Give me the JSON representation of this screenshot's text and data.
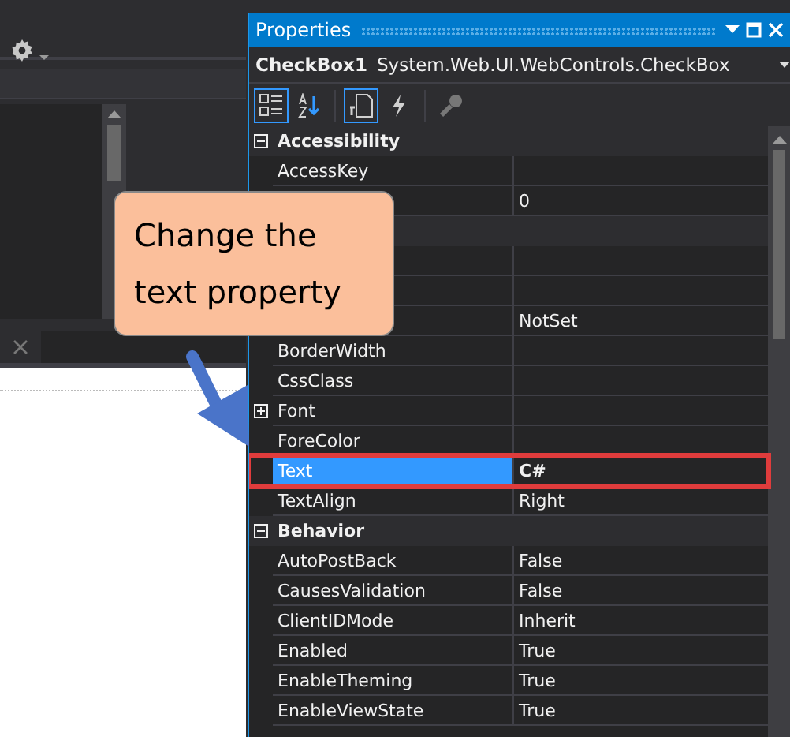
{
  "properties": {
    "title": "Properties",
    "object_name": "CheckBox1",
    "object_type": "System.Web.UI.WebControls.CheckBox",
    "toolbar": [
      {
        "kind": "categorized",
        "selected": true,
        "disabled": false
      },
      {
        "kind": "alphabetical",
        "selected": false,
        "disabled": false
      },
      {
        "kind": "properties",
        "selected": true,
        "disabled": false
      },
      {
        "kind": "events",
        "selected": false,
        "disabled": false
      },
      {
        "kind": "pages",
        "selected": false,
        "disabled": true
      }
    ],
    "rows": [
      {
        "kind": "category",
        "label": "Accessibility",
        "expanded": true
      },
      {
        "kind": "property",
        "name": "AccessKey",
        "selected": false
      },
      {
        "kind": "property",
        "value": "0",
        "selected": false
      },
      {
        "kind": "category"
      },
      {
        "kind": "property",
        "selected": false
      },
      {
        "kind": "property",
        "selected": false
      },
      {
        "kind": "property",
        "value": "NotSet",
        "selected": false
      },
      {
        "kind": "property",
        "name": "BorderWidth",
        "selected": false
      },
      {
        "kind": "property",
        "name": "CssClass",
        "selected": false
      },
      {
        "kind": "property",
        "name": "Font",
        "expanded": false,
        "selected": false
      },
      {
        "kind": "property",
        "name": "ForeColor",
        "selected": false
      },
      {
        "kind": "property",
        "name": "Text",
        "value": "C#",
        "selected": true,
        "modified": true,
        "outlined": true
      },
      {
        "kind": "property",
        "name": "TextAlign",
        "value": "Right",
        "selected": false
      },
      {
        "kind": "category",
        "label": "Behavior",
        "expanded": true
      },
      {
        "kind": "property",
        "name": "AutoPostBack",
        "value": "False",
        "selected": false
      },
      {
        "kind": "property",
        "name": "CausesValidation",
        "value": "False",
        "selected": false
      },
      {
        "kind": "property",
        "name": "ClientIDMode",
        "value": "Inherit",
        "selected": false
      },
      {
        "kind": "property",
        "name": "Enabled",
        "value": "True",
        "selected": false
      },
      {
        "kind": "property",
        "name": "EnableTheming",
        "value": "True",
        "selected": false
      },
      {
        "kind": "property",
        "name": "EnableViewState",
        "value": "True",
        "selected": false
      }
    ]
  },
  "callout": {
    "lines": [
      "Change the",
      "text property"
    ]
  }
}
